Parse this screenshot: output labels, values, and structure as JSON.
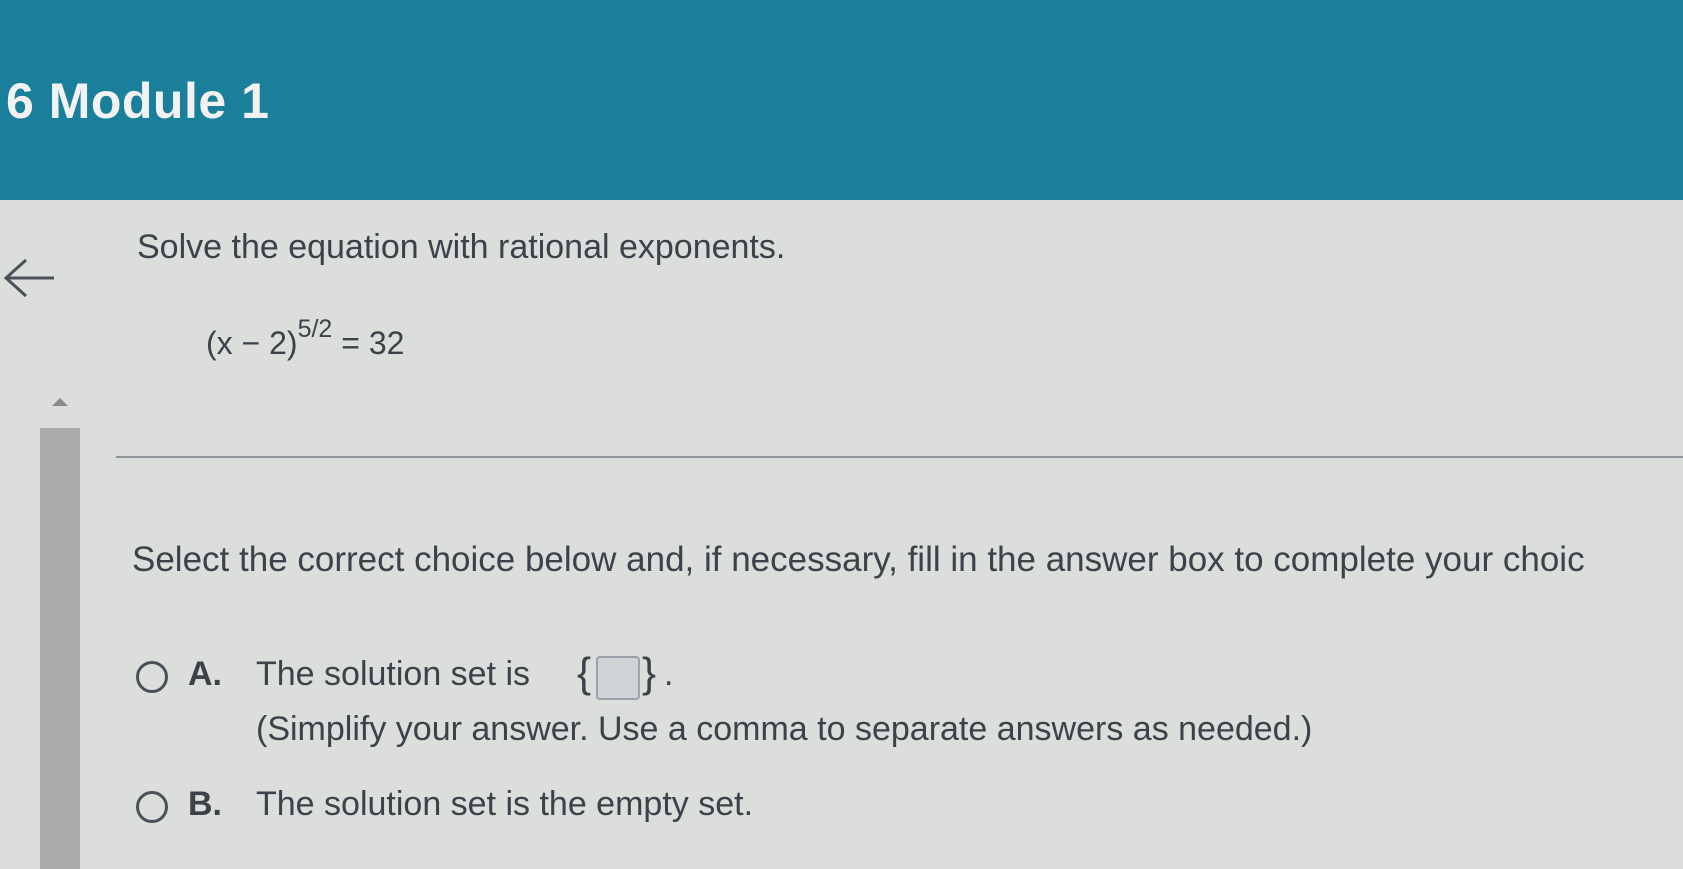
{
  "header": {
    "title": "6 Module 1"
  },
  "question": {
    "prompt": "Solve the equation with rational exponents.",
    "equation_base": "(x − 2)",
    "equation_exponent": "5/2",
    "equation_rhs": "= 32"
  },
  "instruction": "Select the correct choice below and, if necessary, fill in the answer box to complete your choic",
  "choices": [
    {
      "letter": "A.",
      "text": "The solution set is",
      "brace_open": "{",
      "brace_close": "}",
      "period": ".",
      "answer_value": "",
      "hint": "(Simplify your answer. Use a comma to separate answers as needed.)"
    },
    {
      "letter": "B.",
      "text": "The solution set is the empty set."
    }
  ],
  "colors": {
    "header_bg": "#1a7f9b",
    "page_bg": "#dcdedc",
    "text": "#3c414a"
  },
  "icons": {
    "back": "arrow-left-icon",
    "scroll": "scroll-up-icon"
  }
}
